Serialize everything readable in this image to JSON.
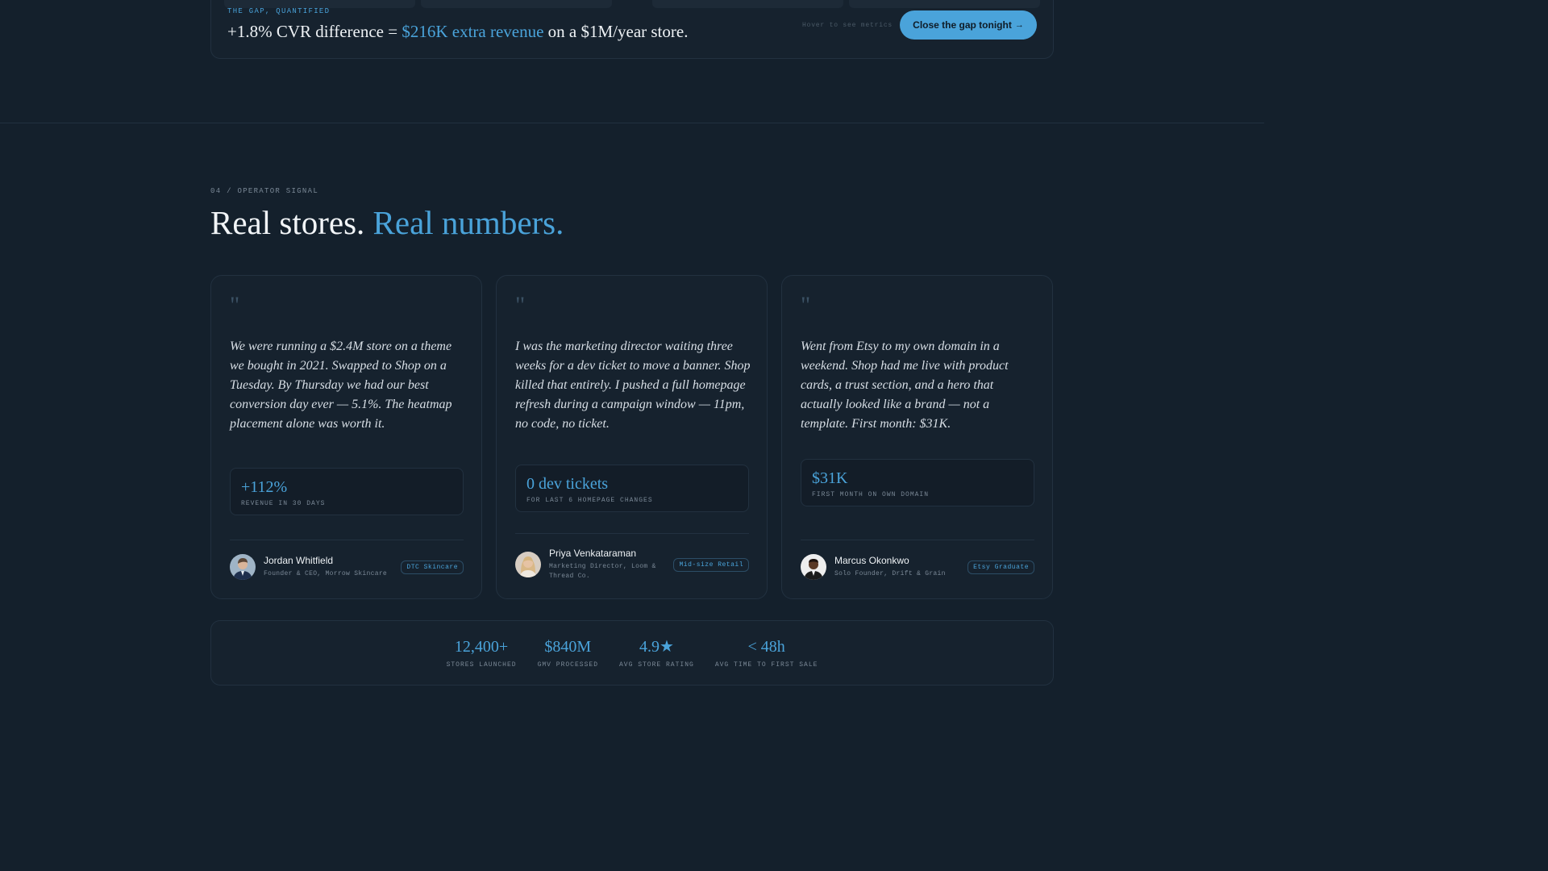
{
  "gap_banner": {
    "eyebrow": "THE GAP, QUANTIFIED",
    "headline_prefix": "+1.8% CVR difference = ",
    "headline_highlight": "$216K extra revenue",
    "headline_suffix": " on a $1M/year store.",
    "hover_hint": "Hover to see metrics",
    "cta_label": "Close the gap tonight",
    "cta_arrow": "→"
  },
  "section": {
    "eyebrow": "04 / OPERATOR SIGNAL",
    "title_plain": "Real stores. ",
    "title_highlight": "Real numbers."
  },
  "testimonials": [
    {
      "quote_mark": "\"",
      "quote": "We were running a $2.4M store on a theme we bought in 2021. Swapped to Shop on a Tuesday. By Thursday we had our best conversion day ever — 5.1%. The heatmap placement alone was worth it.",
      "metric_value": "+112%",
      "metric_label": "REVENUE IN 30 DAYS",
      "name": "Jordan Whitfield",
      "role": "Founder & CEO, Morrow Skincare",
      "tag": "DTC Skincare"
    },
    {
      "quote_mark": "\"",
      "quote": "I was the marketing director waiting three weeks for a dev ticket to move a banner. Shop killed that entirely. I pushed a full homepage refresh during a campaign window — 11pm, no code, no ticket.",
      "metric_value": "0 dev tickets",
      "metric_label": "FOR LAST 6 HOMEPAGE CHANGES",
      "name": "Priya Venkataraman",
      "role": "Marketing Director, Loom & Thread Co.",
      "tag": "Mid-size Retail"
    },
    {
      "quote_mark": "\"",
      "quote": "Went from Etsy to my own domain in a weekend. Shop had me live with product cards, a trust section, and a hero that actually looked like a brand — not a template. First month: $31K.",
      "metric_value": "$31K",
      "metric_label": "FIRST MONTH ON OWN DOMAIN",
      "name": "Marcus Okonkwo",
      "role": "Solo Founder, Drift & Grain",
      "tag": "Etsy Graduate"
    }
  ],
  "stats": [
    {
      "value": "12,400+",
      "label": "STORES LAUNCHED"
    },
    {
      "value": "$840M",
      "label": "GMV PROCESSED"
    },
    {
      "value": "4.9★",
      "label": "AVG STORE RATING"
    },
    {
      "value": "< 48h",
      "label": "AVG TIME TO FIRST SALE"
    }
  ],
  "colors": {
    "background": "#14202c",
    "accent": "#4aa3da",
    "card": "#16222e",
    "border": "#223140"
  }
}
